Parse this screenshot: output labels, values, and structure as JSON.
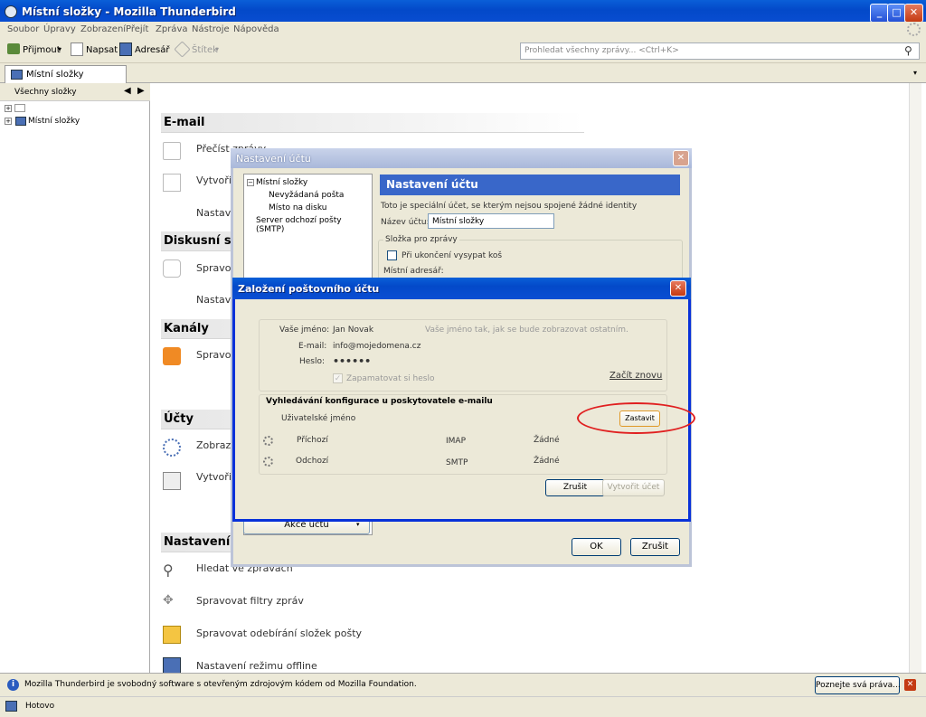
{
  "window": {
    "title": "Místní složky - Mozilla Thunderbird",
    "btn_min": "_",
    "btn_max": "□",
    "btn_close": "✕"
  },
  "menu": [
    "Soubor",
    "Úpravy",
    "Zobrazení",
    "Přejít",
    "Zpráva",
    "Nástroje",
    "Nápověda"
  ],
  "toolbar": {
    "get": "Přijmout",
    "write": "Napsat",
    "address": "Adresář",
    "tag": "Štítek",
    "search_placeholder": "Prohledat všechny zprávy... <Ctrl+K>"
  },
  "tab": {
    "label": "Místní složky"
  },
  "folderpane": {
    "header": "Všechny složky",
    "folder": "Místní složky"
  },
  "content": {
    "email_head": "E-mail",
    "email_read": "Přečíst zprávy",
    "email_write": "Vytvořit",
    "email_settings": "Nastave",
    "news_head": "Diskusní sk",
    "news_manage": "Spravov",
    "news_settings": "Nastave",
    "feeds_head": "Kanály",
    "feeds_manage": "Spravov",
    "accounts_head": "Účty",
    "accounts_show": "Zobrazit",
    "accounts_create": "Vytvořit",
    "settings_head": "Nastavení",
    "search": "Hledat ve zprávách",
    "filters": "Spravovat filtry zpráv",
    "subscribe": "Spravovat odebírání složek pošty",
    "offline": "Nastavení režimu offline"
  },
  "account_settings": {
    "title": "Nastavení účtu",
    "tree": [
      "Místní složky",
      "Nevyžádaná pošta",
      "Místo na disku",
      "Server odchozí pošty (SMTP)"
    ],
    "panel_title": "Nastavení účtu",
    "desc": "Toto je speciální účet, se kterým nejsou spojené žádné identity",
    "name_label": "Název účtu:",
    "name_value": "Místní složky",
    "group_label": "Složka pro zprávy",
    "empty_trash": "Při ukončení vysypat koš",
    "local_dir": "Místní adresář:",
    "actions": "Akce účtu",
    "ok": "OK",
    "cancel": "Zrušit"
  },
  "new_account": {
    "title": "Založení poštovního účtu",
    "name_label": "Vaše jméno:",
    "name_value": "Jan Novak",
    "name_hint": "Vaše jméno tak, jak se bude zobrazovat ostatním.",
    "email_label": "E-mail:",
    "email_value": "info@mojedomena.cz",
    "pass_label": "Heslo:",
    "pass_value": "••••••",
    "remember": "Zapamatovat si heslo",
    "restart": "Začít znovu",
    "lookup_head": "Vyhledávání konfigurace u poskytovatele e-mailu",
    "username": "Uživatelské jméno",
    "stop": "Zastavit",
    "incoming": "Příchozí",
    "incoming_proto": "IMAP",
    "incoming_sec": "Žádné",
    "outgoing": "Odchozí",
    "outgoing_proto": "SMTP",
    "outgoing_sec": "Žádné",
    "cancel": "Zrušit",
    "create": "Vytvořit účet"
  },
  "notification": {
    "text": "Mozilla Thunderbird je svobodný software s otevřeným zdrojovým kódem od Mozilla Foundation.",
    "button": "Poznejte svá práva..."
  },
  "status": {
    "text": "Hotovo"
  }
}
